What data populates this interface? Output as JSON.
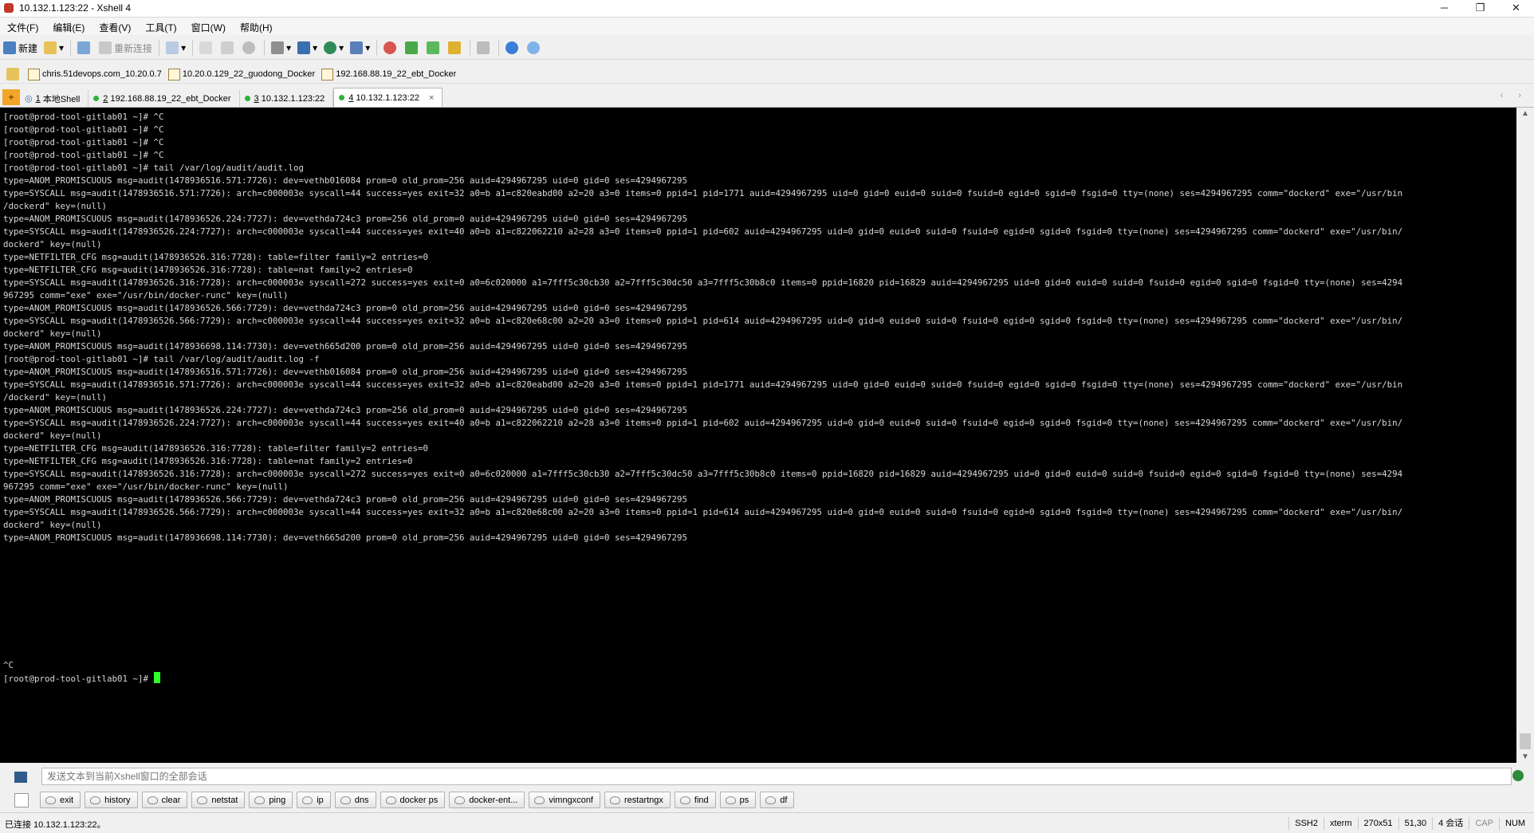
{
  "window": {
    "title": "10.132.1.123:22 - Xshell 4",
    "controls": {
      "minimize": "─",
      "maximize": "❐",
      "close": "✕"
    }
  },
  "menu": [
    "文件(F)",
    "编辑(E)",
    "查看(V)",
    "工具(T)",
    "窗口(W)",
    "帮助(H)"
  ],
  "toolbar": {
    "new_label": "新建",
    "reconnect_label": "重新连接"
  },
  "links": [
    "chris.51devops.com_10.20.0.7",
    "10.20.0.129_22_guodong_Docker",
    "192.168.88.19_22_ebt_Docker"
  ],
  "tabs": [
    {
      "num": "1",
      "label": "本地Shell"
    },
    {
      "num": "2",
      "label": "192.168.88.19_22_ebt_Docker"
    },
    {
      "num": "3",
      "label": "10.132.1.123:22"
    },
    {
      "num": "4",
      "label": "10.132.1.123:22"
    }
  ],
  "active_tab": "4",
  "terminal": {
    "text": "[root@prod-tool-gitlab01 ~]# ^C\n[root@prod-tool-gitlab01 ~]# ^C\n[root@prod-tool-gitlab01 ~]# ^C\n[root@prod-tool-gitlab01 ~]# ^C\n[root@prod-tool-gitlab01 ~]# tail /var/log/audit/audit.log\ntype=ANOM_PROMISCUOUS msg=audit(1478936516.571:7726): dev=vethb016084 prom=0 old_prom=256 auid=4294967295 uid=0 gid=0 ses=4294967295\ntype=SYSCALL msg=audit(1478936516.571:7726): arch=c000003e syscall=44 success=yes exit=32 a0=b a1=c820eabd00 a2=20 a3=0 items=0 ppid=1 pid=1771 auid=4294967295 uid=0 gid=0 euid=0 suid=0 fsuid=0 egid=0 sgid=0 fsgid=0 tty=(none) ses=4294967295 comm=\"dockerd\" exe=\"/usr/bin\n/dockerd\" key=(null)\ntype=ANOM_PROMISCUOUS msg=audit(1478936526.224:7727): dev=vethda724c3 prom=256 old_prom=0 auid=4294967295 uid=0 gid=0 ses=4294967295\ntype=SYSCALL msg=audit(1478936526.224:7727): arch=c000003e syscall=44 success=yes exit=40 a0=b a1=c822062210 a2=28 a3=0 items=0 ppid=1 pid=602 auid=4294967295 uid=0 gid=0 euid=0 suid=0 fsuid=0 egid=0 sgid=0 fsgid=0 tty=(none) ses=4294967295 comm=\"dockerd\" exe=\"/usr/bin/\ndockerd\" key=(null)\ntype=NETFILTER_CFG msg=audit(1478936526.316:7728): table=filter family=2 entries=0\ntype=NETFILTER_CFG msg=audit(1478936526.316:7728): table=nat family=2 entries=0\ntype=SYSCALL msg=audit(1478936526.316:7728): arch=c000003e syscall=272 success=yes exit=0 a0=6c020000 a1=7fff5c30cb30 a2=7fff5c30dc50 a3=7fff5c30b8c0 items=0 ppid=16820 pid=16829 auid=4294967295 uid=0 gid=0 euid=0 suid=0 fsuid=0 egid=0 sgid=0 fsgid=0 tty=(none) ses=4294\n967295 comm=\"exe\" exe=\"/usr/bin/docker-runc\" key=(null)\ntype=ANOM_PROMISCUOUS msg=audit(1478936526.566:7729): dev=vethda724c3 prom=0 old_prom=256 auid=4294967295 uid=0 gid=0 ses=4294967295\ntype=SYSCALL msg=audit(1478936526.566:7729): arch=c000003e syscall=44 success=yes exit=32 a0=b a1=c820e68c00 a2=20 a3=0 items=0 ppid=1 pid=614 auid=4294967295 uid=0 gid=0 euid=0 suid=0 fsuid=0 egid=0 sgid=0 fsgid=0 tty=(none) ses=4294967295 comm=\"dockerd\" exe=\"/usr/bin/\ndockerd\" key=(null)\ntype=ANOM_PROMISCUOUS msg=audit(1478936698.114:7730): dev=veth665d200 prom=0 old_prom=256 auid=4294967295 uid=0 gid=0 ses=4294967295\n[root@prod-tool-gitlab01 ~]# tail /var/log/audit/audit.log -f\ntype=ANOM_PROMISCUOUS msg=audit(1478936516.571:7726): dev=vethb016084 prom=0 old_prom=256 auid=4294967295 uid=0 gid=0 ses=4294967295\ntype=SYSCALL msg=audit(1478936516.571:7726): arch=c000003e syscall=44 success=yes exit=32 a0=b a1=c820eabd00 a2=20 a3=0 items=0 ppid=1 pid=1771 auid=4294967295 uid=0 gid=0 euid=0 suid=0 fsuid=0 egid=0 sgid=0 fsgid=0 tty=(none) ses=4294967295 comm=\"dockerd\" exe=\"/usr/bin\n/dockerd\" key=(null)\ntype=ANOM_PROMISCUOUS msg=audit(1478936526.224:7727): dev=vethda724c3 prom=256 old_prom=0 auid=4294967295 uid=0 gid=0 ses=4294967295\ntype=SYSCALL msg=audit(1478936526.224:7727): arch=c000003e syscall=44 success=yes exit=40 a0=b a1=c822062210 a2=28 a3=0 items=0 ppid=1 pid=602 auid=4294967295 uid=0 gid=0 euid=0 suid=0 fsuid=0 egid=0 sgid=0 fsgid=0 tty=(none) ses=4294967295 comm=\"dockerd\" exe=\"/usr/bin/\ndockerd\" key=(null)\ntype=NETFILTER_CFG msg=audit(1478936526.316:7728): table=filter family=2 entries=0\ntype=NETFILTER_CFG msg=audit(1478936526.316:7728): table=nat family=2 entries=0\ntype=SYSCALL msg=audit(1478936526.316:7728): arch=c000003e syscall=272 success=yes exit=0 a0=6c020000 a1=7fff5c30cb30 a2=7fff5c30dc50 a3=7fff5c30b8c0 items=0 ppid=16820 pid=16829 auid=4294967295 uid=0 gid=0 euid=0 suid=0 fsuid=0 egid=0 sgid=0 fsgid=0 tty=(none) ses=4294\n967295 comm=\"exe\" exe=\"/usr/bin/docker-runc\" key=(null)\ntype=ANOM_PROMISCUOUS msg=audit(1478936526.566:7729): dev=vethda724c3 prom=0 old_prom=256 auid=4294967295 uid=0 gid=0 ses=4294967295\ntype=SYSCALL msg=audit(1478936526.566:7729): arch=c000003e syscall=44 success=yes exit=32 a0=b a1=c820e68c00 a2=20 a3=0 items=0 ppid=1 pid=614 auid=4294967295 uid=0 gid=0 euid=0 suid=0 fsuid=0 egid=0 sgid=0 fsgid=0 tty=(none) ses=4294967295 comm=\"dockerd\" exe=\"/usr/bin/\ndockerd\" key=(null)\ntype=ANOM_PROMISCUOUS msg=audit(1478936698.114:7730): dev=veth665d200 prom=0 old_prom=256 auid=4294967295 uid=0 gid=0 ses=4294967295",
    "interrupt": "^C",
    "prompt": "[root@prod-tool-gitlab01 ~]# ",
    "cursor_color": "#2cff2c"
  },
  "compose": {
    "placeholder": "发送文本到当前Xshell窗口的全部会话"
  },
  "quick_commands": [
    "exit",
    "history",
    "clear",
    "netstat",
    "ping",
    "ip",
    "dns",
    "docker ps",
    "docker-ent...",
    "vimngxconf",
    "restartngx",
    "find",
    "ps",
    "df"
  ],
  "status": {
    "connected": "已连接 10.132.1.123:22。",
    "protocol": "SSH2",
    "term": "xterm",
    "size": "270x51",
    "position": "51,30",
    "sessions": "4 会话",
    "caps": "CAP",
    "num": "NUM"
  }
}
